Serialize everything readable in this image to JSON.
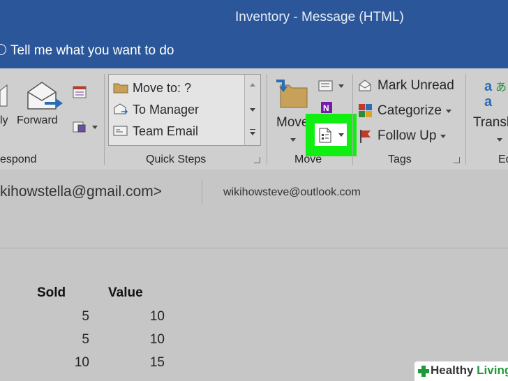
{
  "window": {
    "title": "Inventory  -  Message (HTML)"
  },
  "tell_me": "Tell me what you want to do",
  "ribbon": {
    "respond": {
      "reply": "ly",
      "forward": "Forward",
      "group": "espond"
    },
    "quick_steps": {
      "items": [
        "Move to: ?",
        "To Manager",
        "Team Email"
      ],
      "group": "Quick Steps"
    },
    "move": {
      "move": "Move",
      "group": "Move"
    },
    "tags": {
      "mark_unread": "Mark Unread",
      "categorize": "Categorize",
      "follow_up": "Follow Up",
      "group": "Tags"
    },
    "translate": {
      "label": "Transl",
      "group": "Ed"
    },
    "highlight_color": "#11ee11"
  },
  "header": {
    "from": "kihowstella@gmail.com>",
    "to": "wikihowsteve@outlook.com"
  },
  "table": {
    "headers": [
      "Sold",
      "Value"
    ],
    "rows": [
      [
        "5",
        "10"
      ],
      [
        "5",
        "10"
      ],
      [
        "10",
        "15"
      ]
    ]
  },
  "watermark": {
    "brand1": "Healthy",
    "brand2": "Living"
  }
}
